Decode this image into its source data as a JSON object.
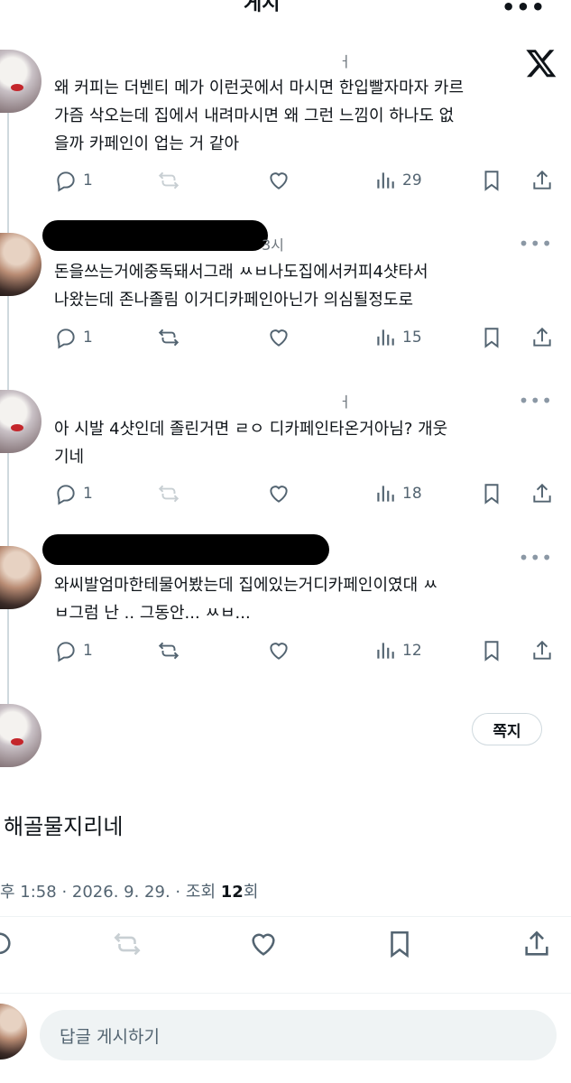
{
  "header": {
    "title": "게시",
    "more_icon": "more-horizontal-icon"
  },
  "brand": {
    "logo": "x-logo-icon"
  },
  "replies": [
    {
      "avatar": "avatar-white-face",
      "meta_fragment": "ㅓ",
      "text": "왜 커피는 더벤티 메가 이런곳에서 마시면 한입빨자마자 카르\n가즘 삭오는데 집에서 내려마시면 왜 그런 느낌이 하나도 없\n을까 카페인이 업는 거 같아",
      "actions": {
        "replies": "1",
        "reposts": "",
        "likes": "",
        "views": "29"
      }
    },
    {
      "avatar": "avatar-dark-hair",
      "meta_fragment": "3시",
      "text": "돈을쓰는거에중독돼서그래 ㅆㅂ나도집에서커피4샷타서\n나왔는데 존나졸림 이거디카페인아닌가 의심될정도로",
      "actions": {
        "replies": "1",
        "reposts": "",
        "likes": "",
        "views": "15"
      }
    },
    {
      "avatar": "avatar-white-face",
      "meta_fragment": "ㅓ",
      "text": "아 시발 4샷인데 졸린거면 ㄹㅇ 디카페인타온거아님? 개웃\n기네",
      "actions": {
        "replies": "1",
        "reposts": "",
        "likes": "",
        "views": "18"
      }
    },
    {
      "avatar": "avatar-dark-hair",
      "meta_fragment": "",
      "text": "와씨발엄마한테물어봤는데 집에있는거디카페인이였대 ㅆ\nㅂ그럼 난 .. 그동안... ㅆㅂ...",
      "actions": {
        "replies": "1",
        "reposts": "",
        "likes": "",
        "views": "12"
      }
    }
  ],
  "main_post": {
    "dm_button": "쪽지",
    "text": "해골물지리네",
    "time": "후 1:58",
    "date": "2026. 9. 29.",
    "views_label": "조회",
    "views_count": "12",
    "views_suffix": "회",
    "separator": "·"
  },
  "composer": {
    "placeholder": "답글 게시하기"
  },
  "colors": {
    "text": "#0f1419",
    "secondary": "#536471",
    "border": "#cfd9de",
    "input_bg": "#eff3f4"
  }
}
